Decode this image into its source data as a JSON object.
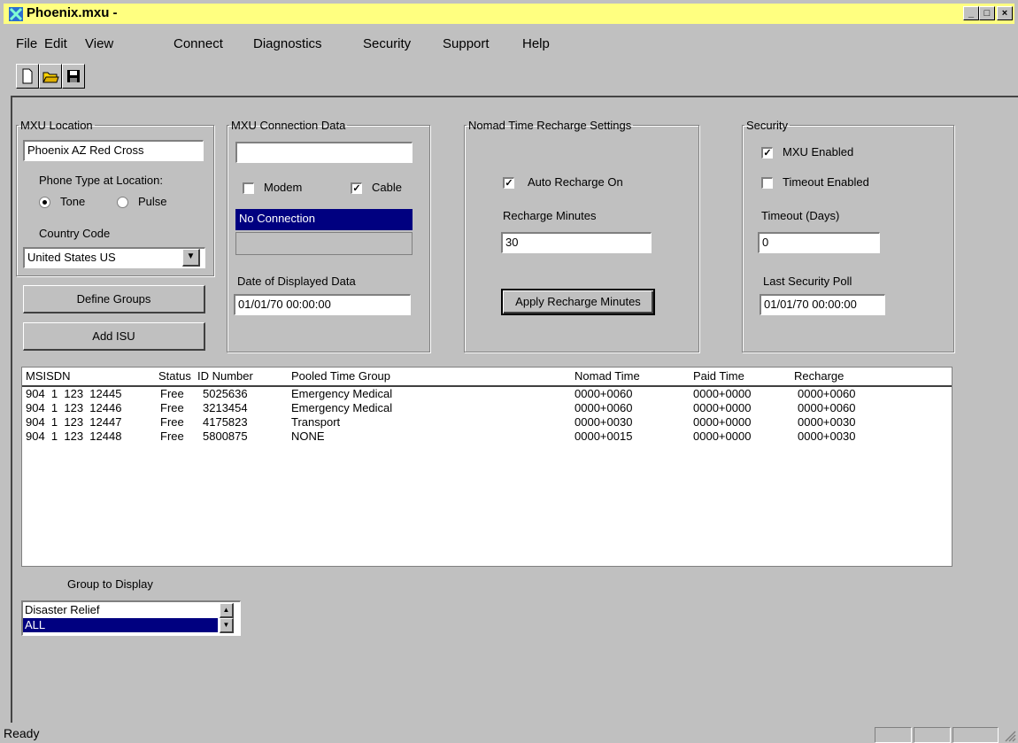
{
  "window": {
    "title": "Phoenix.mxu -",
    "minimize": "_",
    "maximize": "□",
    "close": "×"
  },
  "menu": [
    "File",
    "Edit",
    "View",
    "Connect",
    "Diagnostics",
    "Security",
    "Support",
    "Help"
  ],
  "location": {
    "legend": "MXU Location",
    "name": "Phoenix AZ Red Cross",
    "phone_type_label": "Phone Type at Location:",
    "tone": "Tone",
    "pulse": "Pulse",
    "country_label": "Country Code",
    "country": "United States US"
  },
  "buttons": {
    "define_groups": "Define Groups",
    "add_isu": "Add ISU",
    "apply_recharge": "Apply Recharge Minutes"
  },
  "connection": {
    "legend": "MXU Connection Data",
    "field": "",
    "modem": "Modem",
    "cable": "Cable",
    "status": "No Connection",
    "date_label": "Date of Displayed Data",
    "date": "01/01/70 00:00:00"
  },
  "recharge": {
    "legend": "Nomad Time Recharge Settings",
    "auto": "Auto Recharge On",
    "minutes_label": "Recharge Minutes",
    "minutes": "30"
  },
  "security": {
    "legend": "Security",
    "mxu_enabled": "MXU Enabled",
    "timeout_enabled": "Timeout Enabled",
    "timeout_label": "Timeout (Days)",
    "timeout": "0",
    "poll_label": "Last Security Poll",
    "poll": "01/01/70 00:00:00"
  },
  "table": {
    "headers": [
      "MSISDN",
      "Status",
      "ID Number",
      "Pooled Time Group",
      "Nomad Time",
      "Paid Time",
      "Recharge"
    ],
    "rows": [
      [
        "904  1  123  12445",
        "Free",
        "5025636",
        "Emergency Medical",
        "0000+0060",
        "0000+0000",
        "0000+0060"
      ],
      [
        "904  1  123  12446",
        "Free",
        "3213454",
        "Emergency Medical",
        "0000+0060",
        "0000+0000",
        "0000+0060"
      ],
      [
        "904  1  123  12447",
        "Free",
        "4175823",
        "Transport",
        "0000+0030",
        "0000+0000",
        "0000+0030"
      ],
      [
        "904  1  123  12448",
        "Free",
        "5800875",
        "NONE",
        "0000+0015",
        "0000+0000",
        "0000+0030"
      ]
    ]
  },
  "group_display": {
    "label": "Group to Display",
    "options": [
      "Disaster Relief",
      "ALL"
    ],
    "selected": "ALL"
  },
  "status": {
    "text": "Ready"
  },
  "colors": {
    "title_bg": "#ffff80",
    "selection": "#000080",
    "face": "#c0c0c0"
  }
}
